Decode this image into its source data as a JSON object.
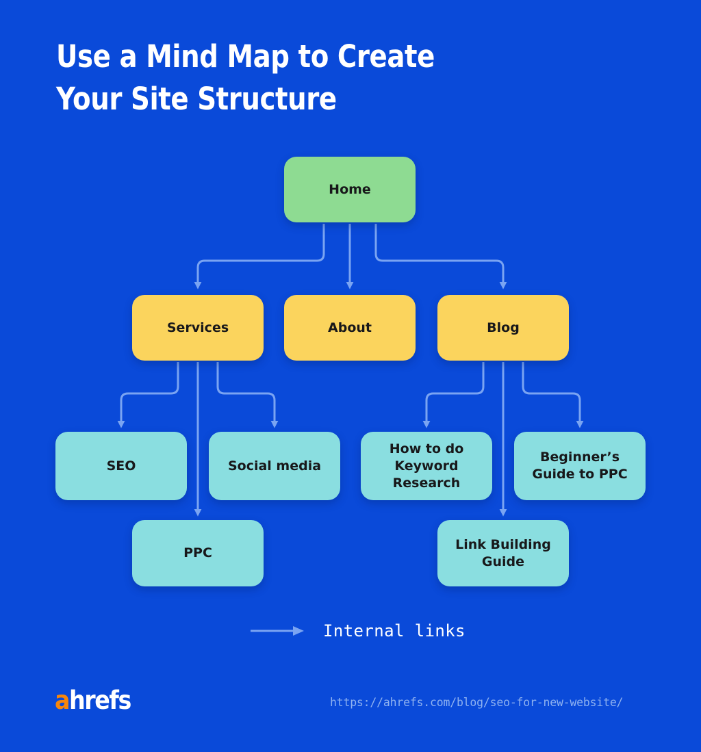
{
  "title": "Use a Mind Map to Create\nYour Site Structure",
  "colors": {
    "background": "#0a4ad9",
    "root_node": "#8edb92",
    "level1_node": "#fbd45d",
    "level2_node": "#8adee0",
    "connector": "#7aa4f2",
    "node_text": "#18181a",
    "title_text": "#ffffff",
    "logo_accent": "#f7860b",
    "url_text": "#8fb2f0"
  },
  "diagram": {
    "type": "mind-map",
    "nodes": [
      {
        "id": "home",
        "label": "Home",
        "level": 0,
        "color": "root_node"
      },
      {
        "id": "services",
        "label": "Services",
        "level": 1,
        "color": "level1_node"
      },
      {
        "id": "about",
        "label": "About",
        "level": 1,
        "color": "level1_node"
      },
      {
        "id": "blog",
        "label": "Blog",
        "level": 1,
        "color": "level1_node"
      },
      {
        "id": "seo",
        "label": "SEO",
        "level": 2,
        "color": "level2_node"
      },
      {
        "id": "social",
        "label": "Social media",
        "level": 2,
        "color": "level2_node"
      },
      {
        "id": "keyword",
        "label": "How to do\nKeyword\nResearch",
        "level": 2,
        "color": "level2_node"
      },
      {
        "id": "beginners",
        "label": "Beginner’s\nGuide to PPC",
        "level": 2,
        "color": "level2_node"
      },
      {
        "id": "ppc",
        "label": "PPC",
        "level": 2,
        "color": "level2_node"
      },
      {
        "id": "linkguide",
        "label": "Link Building\nGuide",
        "level": 2,
        "color": "level2_node"
      }
    ],
    "edges": [
      {
        "from": "home",
        "to": "services"
      },
      {
        "from": "home",
        "to": "about"
      },
      {
        "from": "home",
        "to": "blog"
      },
      {
        "from": "services",
        "to": "seo"
      },
      {
        "from": "services",
        "to": "social"
      },
      {
        "from": "services",
        "to": "ppc"
      },
      {
        "from": "blog",
        "to": "keyword"
      },
      {
        "from": "blog",
        "to": "beginners"
      },
      {
        "from": "blog",
        "to": "linkguide"
      }
    ]
  },
  "legend": {
    "label": "Internal links",
    "icon": "arrow-right-icon"
  },
  "footer": {
    "logo_accent": "a",
    "logo_rest": "hrefs",
    "url": "https://ahrefs.com/blog/seo-for-new-website/"
  }
}
